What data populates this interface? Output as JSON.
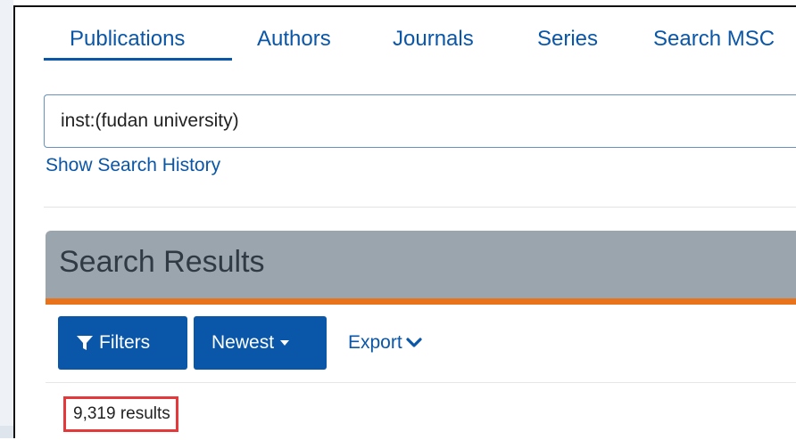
{
  "tabs": [
    {
      "label": "Publications",
      "active": true
    },
    {
      "label": "Authors",
      "active": false
    },
    {
      "label": "Journals",
      "active": false
    },
    {
      "label": "Series",
      "active": false
    },
    {
      "label": "Search MSC",
      "active": false
    }
  ],
  "search": {
    "value": "inst:(fudan university)"
  },
  "history_link": "Show Search History",
  "results": {
    "title": "Search Results",
    "filters_label": "Filters",
    "sort_label": "Newest",
    "export_label": "Export",
    "count_text": "9,319 results"
  },
  "colors": {
    "link": "#0a56a8",
    "header_bg": "#9aa5ad",
    "accent_bar": "#e8731a",
    "highlight": "#e5383b"
  },
  "icons": [
    "funnel-icon",
    "caret-down-icon",
    "chevron-down-icon"
  ]
}
